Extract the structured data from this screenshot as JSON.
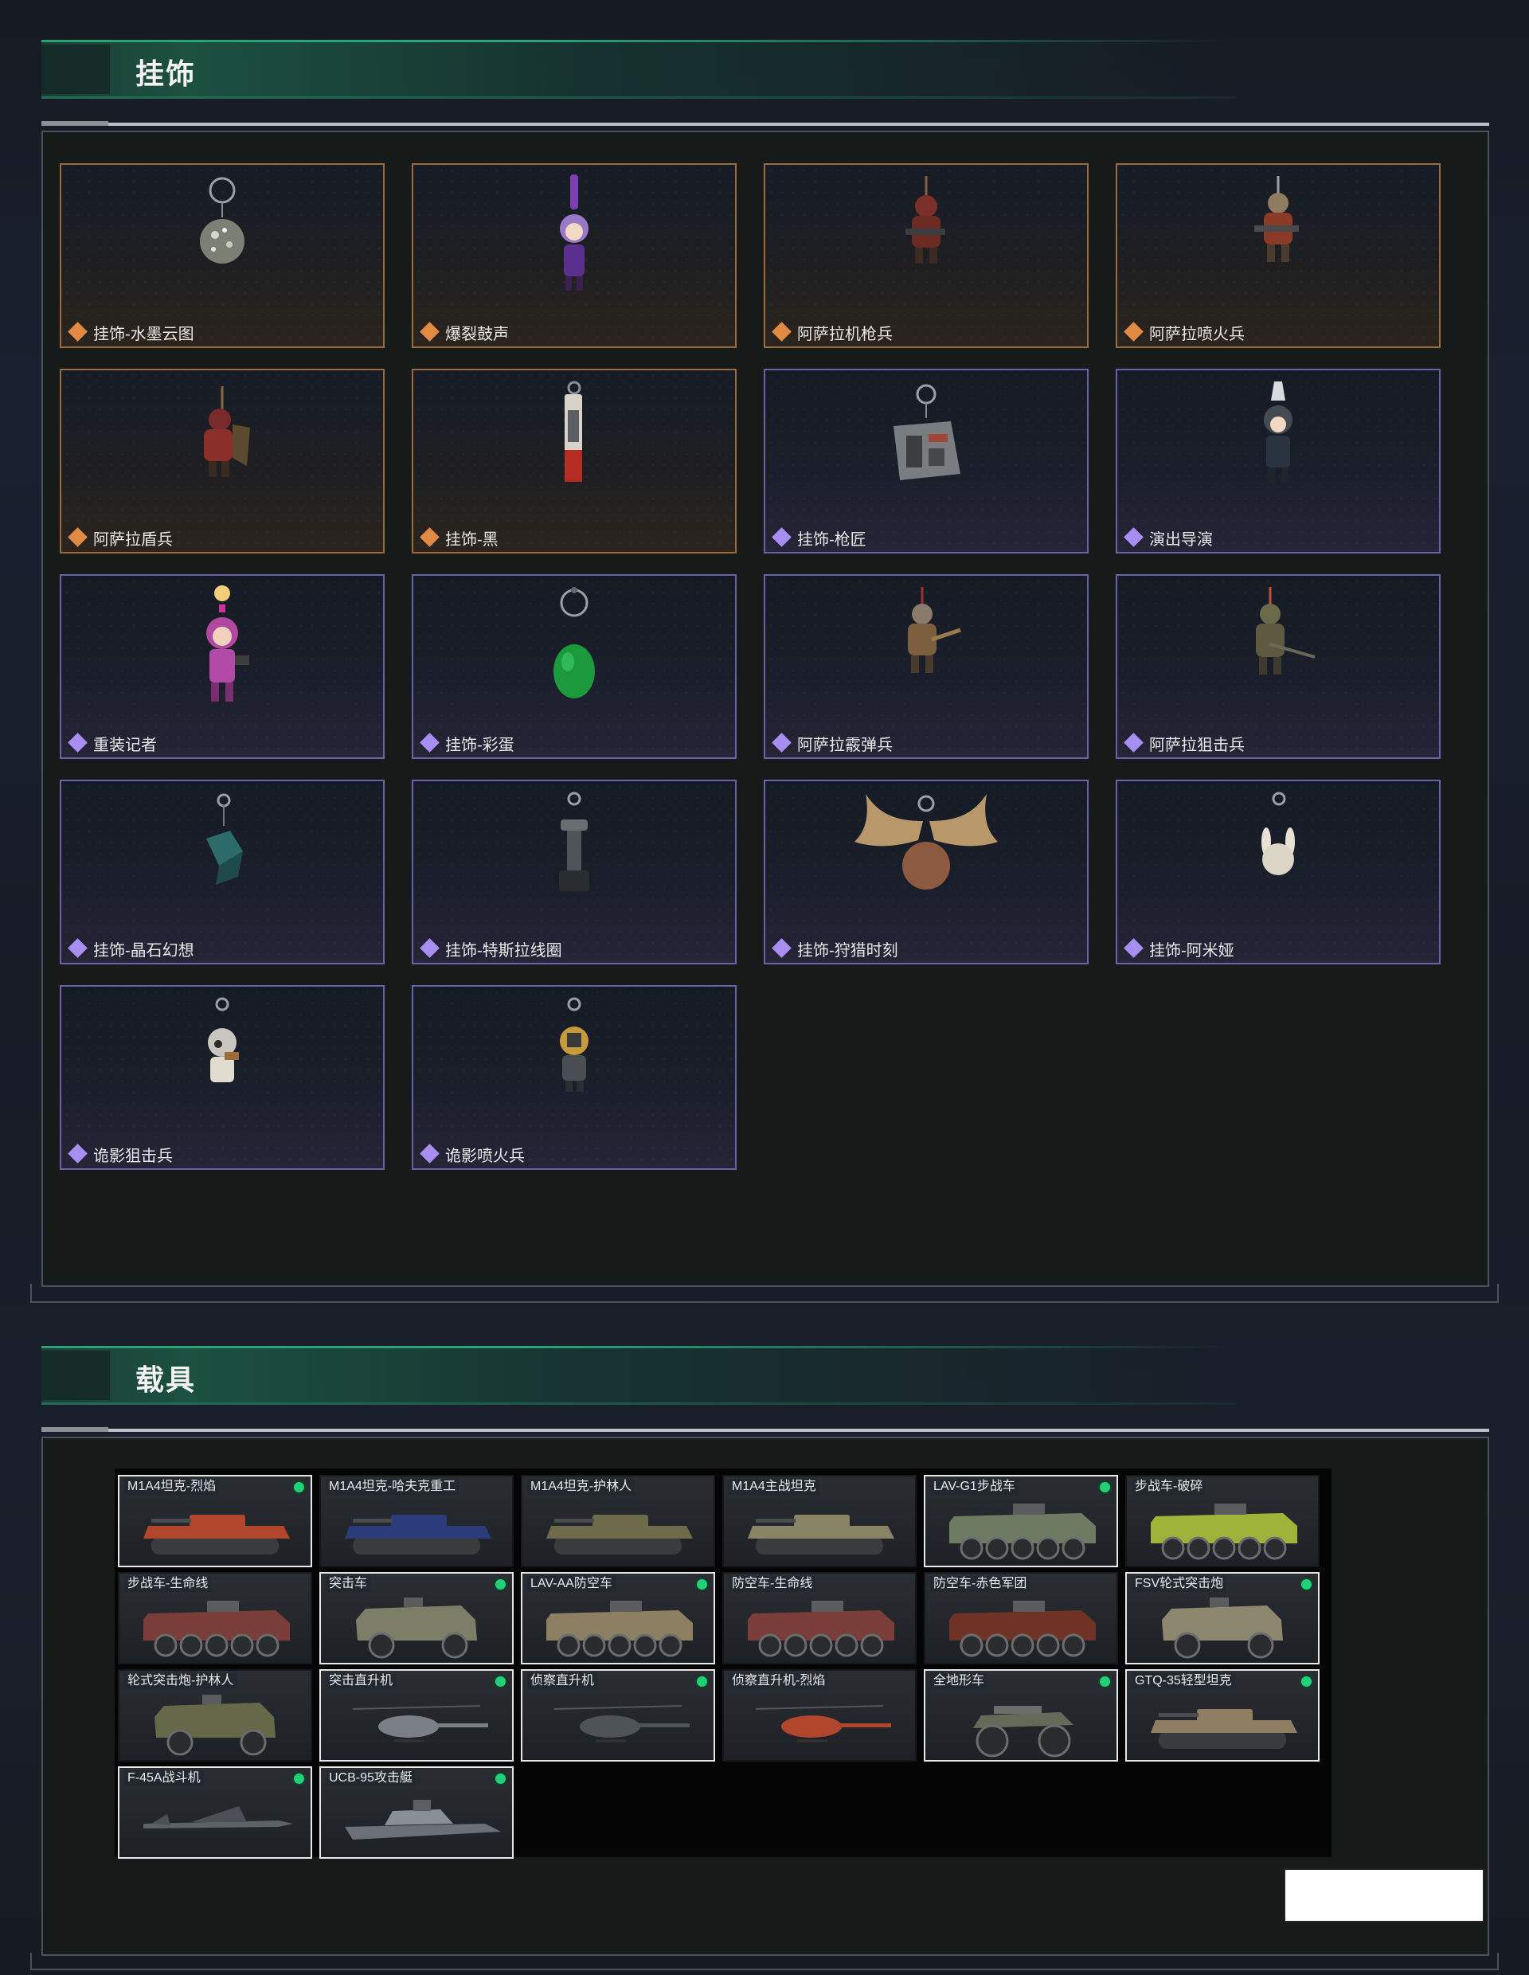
{
  "charms_section": {
    "title": "挂饰",
    "items": [
      {
        "label": "挂饰-水墨云图",
        "rarity": "orange",
        "icon": "disco-ball-charm-icon"
      },
      {
        "label": "爆裂鼓声",
        "rarity": "orange",
        "icon": "drummer-figure-charm-icon"
      },
      {
        "label": "阿萨拉机枪兵",
        "rarity": "orange",
        "icon": "gunner-figure-charm-icon"
      },
      {
        "label": "阿萨拉喷火兵",
        "rarity": "orange",
        "icon": "flamethrower-figure-charm-icon"
      },
      {
        "label": "阿萨拉盾兵",
        "rarity": "orange",
        "icon": "shield-figure-charm-icon"
      },
      {
        "label": "挂饰-黑",
        "rarity": "orange",
        "icon": "black-magazine-charm-icon"
      },
      {
        "label": "挂饰-枪匠",
        "rarity": "purple",
        "icon": "gunsmith-case-charm-icon"
      },
      {
        "label": "演出导演",
        "rarity": "purple",
        "icon": "director-figure-charm-icon"
      },
      {
        "label": "重装记者",
        "rarity": "purple",
        "icon": "reporter-figure-charm-icon"
      },
      {
        "label": "挂饰-彩蛋",
        "rarity": "purple",
        "icon": "green-egg-charm-icon"
      },
      {
        "label": "阿萨拉霰弹兵",
        "rarity": "purple",
        "icon": "shotgunner-figure-charm-icon"
      },
      {
        "label": "阿萨拉狙击兵",
        "rarity": "purple",
        "icon": "sniper-figure-charm-icon"
      },
      {
        "label": "挂饰-晶石幻想",
        "rarity": "purple",
        "icon": "crystal-cube-charm-icon"
      },
      {
        "label": "挂饰-特斯拉线圈",
        "rarity": "purple",
        "icon": "tesla-coil-charm-icon"
      },
      {
        "label": "挂饰-狩猎时刻",
        "rarity": "purple",
        "icon": "moose-antler-charm-icon"
      },
      {
        "label": "挂饰-阿米娅",
        "rarity": "purple",
        "icon": "amiya-bunny-charm-icon"
      },
      {
        "label": "诡影狙击兵",
        "rarity": "purple",
        "icon": "ghost-sniper-charm-icon"
      },
      {
        "label": "诡影喷火兵",
        "rarity": "purple",
        "icon": "ghost-flamethrower-charm-icon"
      }
    ]
  },
  "vehicles_section": {
    "title": "载具",
    "items": [
      {
        "label": "M1A4坦克-烈焰",
        "owned": true,
        "selected": true,
        "type": "tank",
        "color": "#b0462c"
      },
      {
        "label": "M1A4坦克-哈夫克重工",
        "owned": false,
        "selected": false,
        "type": "tank",
        "color": "#2a3d7a"
      },
      {
        "label": "M1A4坦克-护林人",
        "owned": false,
        "selected": false,
        "type": "tank",
        "color": "#6e6a4c"
      },
      {
        "label": "M1A4主战坦克",
        "owned": false,
        "selected": false,
        "type": "tank",
        "color": "#8a8466"
      },
      {
        "label": "LAV-G1步战车",
        "owned": true,
        "selected": true,
        "type": "apc",
        "color": "#6f7a63"
      },
      {
        "label": "步战车-破碎",
        "owned": false,
        "selected": false,
        "type": "apc",
        "color": "#9fb33a"
      },
      {
        "label": "步战车-生命线",
        "owned": false,
        "selected": false,
        "type": "apc",
        "color": "#7a3e3a"
      },
      {
        "label": "突击车",
        "owned": true,
        "selected": true,
        "type": "truck",
        "color": "#7d7e68"
      },
      {
        "label": "LAV-AA防空车",
        "owned": true,
        "selected": true,
        "type": "apc",
        "color": "#8c7f62"
      },
      {
        "label": "防空车-生命线",
        "owned": false,
        "selected": false,
        "type": "apc",
        "color": "#7a3e3a"
      },
      {
        "label": "防空车-赤色军团",
        "owned": false,
        "selected": false,
        "type": "apc",
        "color": "#6e3326"
      },
      {
        "label": "FSV轮式突击炮",
        "owned": true,
        "selected": true,
        "type": "truck",
        "color": "#8e876f"
      },
      {
        "label": "轮式突击炮-护林人",
        "owned": false,
        "selected": false,
        "type": "truck",
        "color": "#66684a"
      },
      {
        "label": "突击直升机",
        "owned": true,
        "selected": true,
        "type": "heli",
        "color": "#7a7f85"
      },
      {
        "label": "侦察直升机",
        "owned": true,
        "selected": true,
        "type": "heli",
        "color": "#4e5358"
      },
      {
        "label": "侦察直升机-烈焰",
        "owned": false,
        "selected": false,
        "type": "heli",
        "color": "#b0462c"
      },
      {
        "label": "全地形车",
        "owned": true,
        "selected": true,
        "type": "atv",
        "color": "#646a58"
      },
      {
        "label": "GTQ-35轻型坦克",
        "owned": true,
        "selected": true,
        "type": "tank",
        "color": "#8e7e62"
      },
      {
        "label": "F-45A战斗机",
        "owned": true,
        "selected": true,
        "type": "jet",
        "color": "#5d6268"
      },
      {
        "label": "UCB-95攻击艇",
        "owned": true,
        "selected": true,
        "type": "boat",
        "color": "#6b7077"
      }
    ]
  }
}
